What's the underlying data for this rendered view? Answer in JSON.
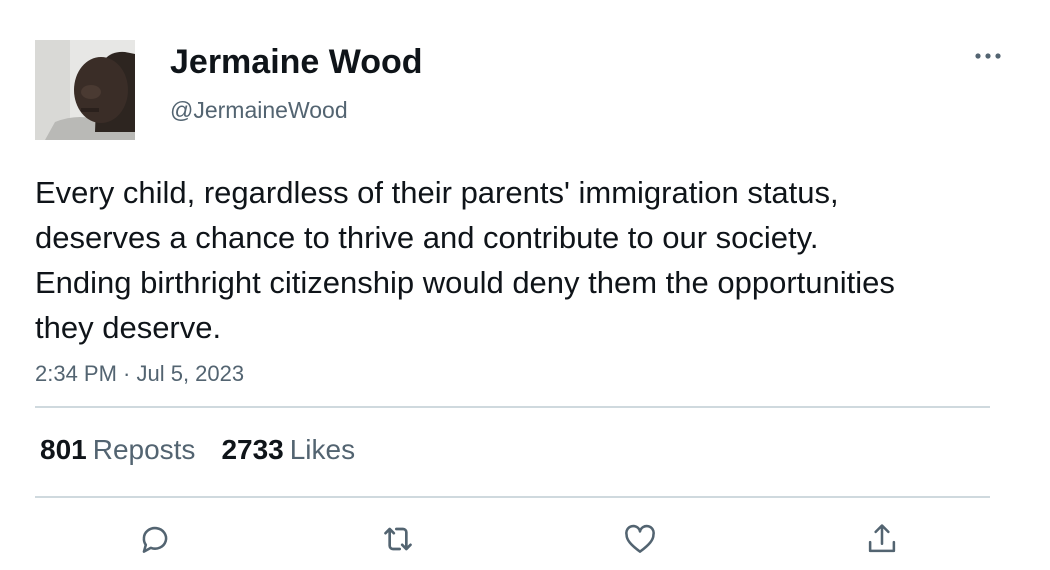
{
  "author": {
    "display_name": "Jermaine Wood",
    "handle": "@JermaineWood"
  },
  "tweet": {
    "text": "Every child, regardless of their parents' immigration status, deserves a chance to thrive and contribute to our society. Ending birthright citizenship would deny them the opportunities they deserve.",
    "timestamp": "2:34 PM · Jul 5, 2023"
  },
  "stats": {
    "reposts_count": "801",
    "reposts_label": "Reposts",
    "likes_count": "2733",
    "likes_label": "Likes"
  },
  "icons": {
    "more": "more-icon",
    "reply": "reply-icon",
    "repost": "repost-icon",
    "like": "like-icon",
    "share": "share-icon"
  },
  "colors": {
    "text_primary": "#0f1419",
    "text_secondary": "#536471",
    "divider": "#cfd9de"
  }
}
